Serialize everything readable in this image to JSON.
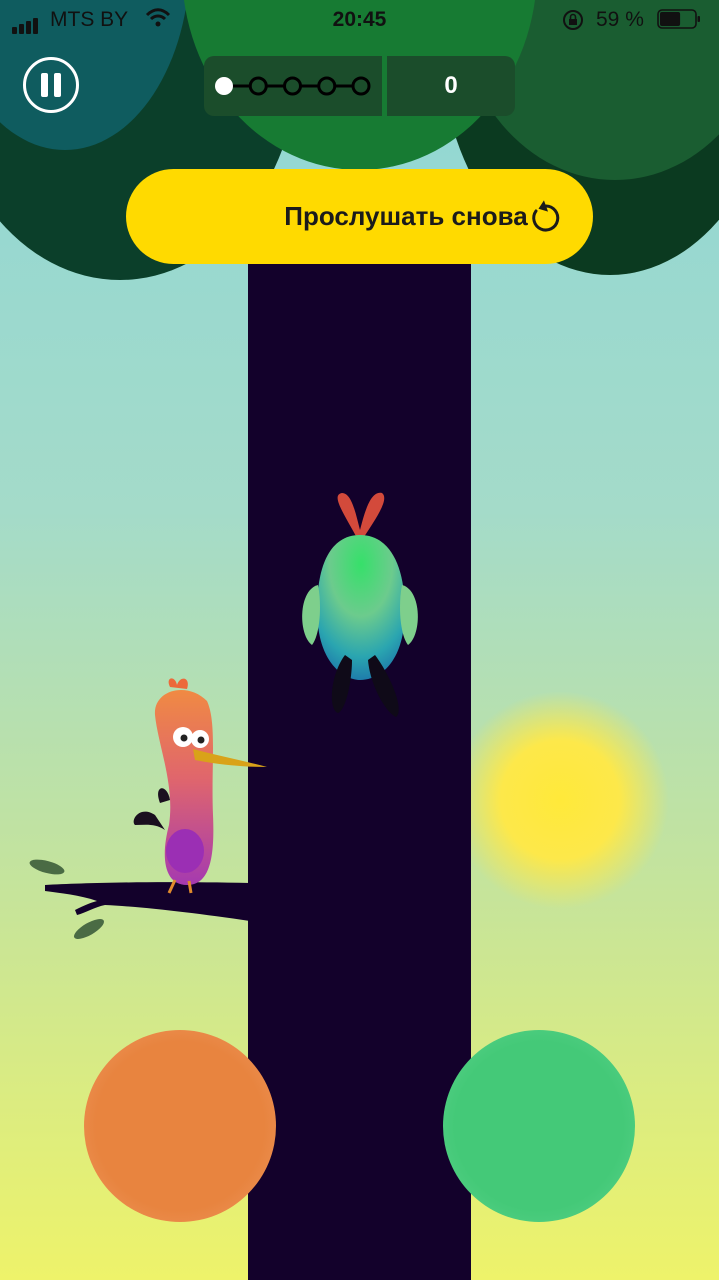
{
  "status_bar": {
    "carrier": "MTS BY",
    "time": "20:45",
    "battery": "59 %",
    "battery_level": 0.59
  },
  "hud": {
    "progress_total": 5,
    "progress_current": 1,
    "score": "0"
  },
  "replay_button": {
    "label": "Прослушать снова"
  },
  "colors": {
    "replay_button": "#ffda00",
    "answer_left": "#e8843f",
    "answer_right": "#44c978",
    "trunk": "#13012b"
  },
  "icons": [
    "pause-icon",
    "replay-icon",
    "signal-icon",
    "wifi-icon",
    "rotation-lock-icon",
    "battery-icon"
  ]
}
